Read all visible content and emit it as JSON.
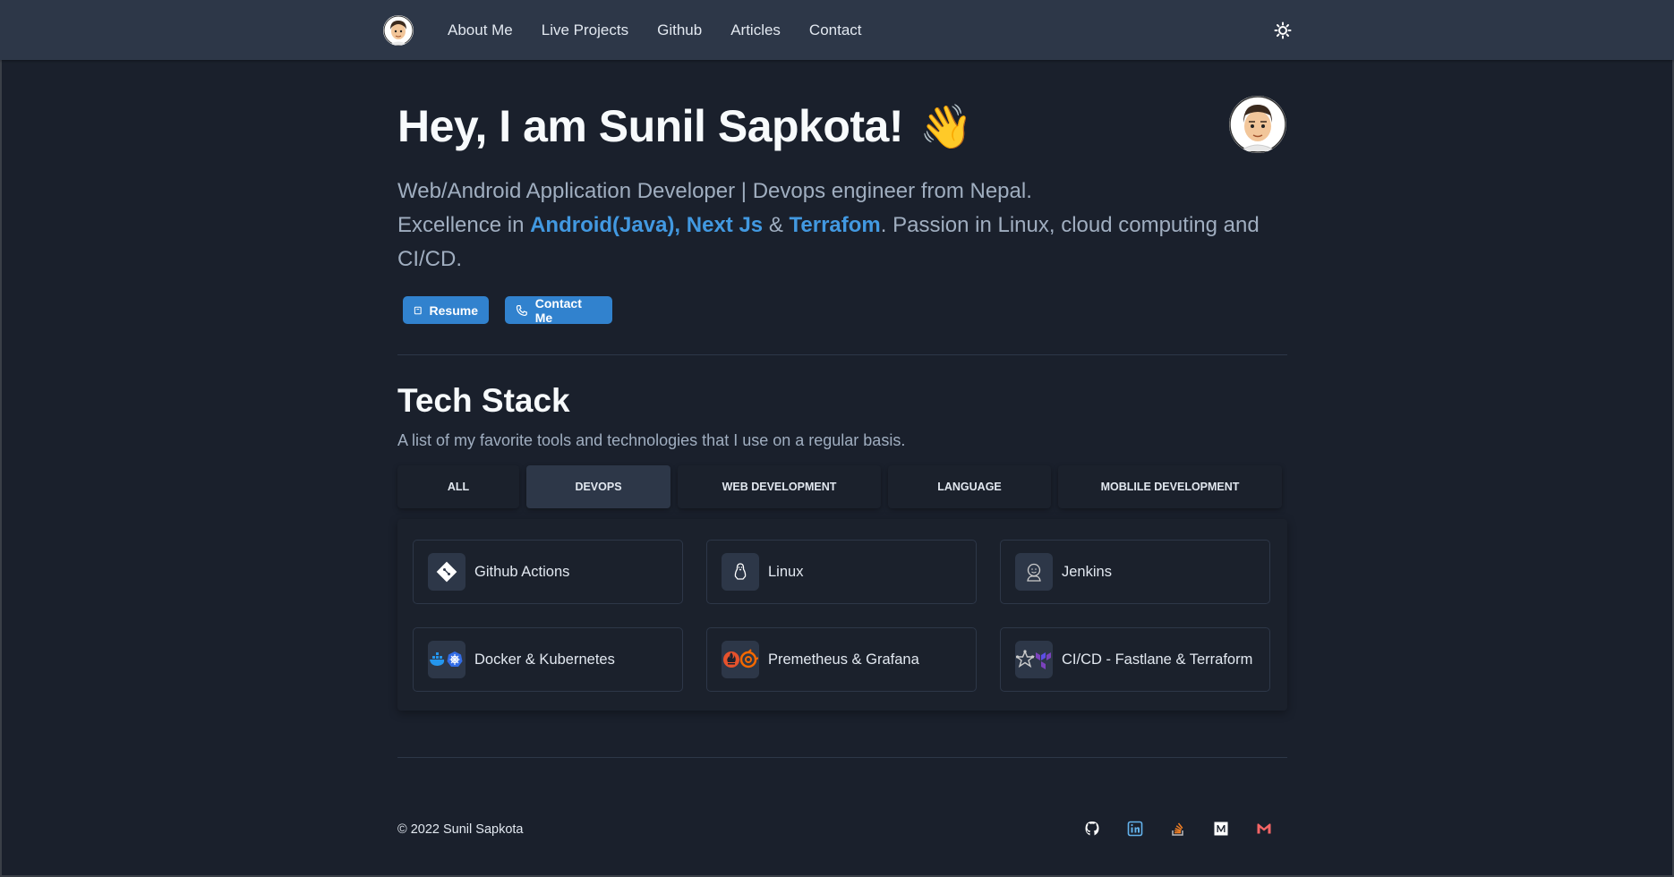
{
  "nav": {
    "links": [
      "About Me",
      "Live Projects",
      "Github",
      "Articles",
      "Contact"
    ]
  },
  "hero": {
    "title": "Hey, I am Sunil Sapkota!",
    "wave": "👋",
    "line1": "Web/Android Application Developer | Devops engineer from Nepal.",
    "line2_prefix": "Excellence in ",
    "highlight1": "Android(Java), Next Js",
    "amp": " & ",
    "highlight2": "Terrafom",
    "line2_suffix": ". Passion in Linux, cloud computing and CI/CD.",
    "resume_label": "Resume",
    "contact_label": "Contact Me"
  },
  "tech": {
    "title": "Tech Stack",
    "description": "A list of my favorite tools and technologies that I use on a regular basis.",
    "tabs": [
      "ALL",
      "DEVOPS",
      "WEB DEVELOPMENT",
      "LANGUAGE",
      "MOBLILE DEVELOPMENT"
    ],
    "active_tab": "DEVOPS",
    "items": [
      {
        "label": "Github Actions",
        "icon": "git-icon"
      },
      {
        "label": "Linux",
        "icon": "linux-icon"
      },
      {
        "label": "Jenkins",
        "icon": "jenkins-icon"
      },
      {
        "label": "Docker & Kubernetes",
        "icon": "docker-kubernetes-icon"
      },
      {
        "label": "Premetheus & Grafana",
        "icon": "prometheus-grafana-icon"
      },
      {
        "label": "CI/CD - Fastlane & Terraform",
        "icon": "fastlane-terraform-icon"
      }
    ]
  },
  "footer": {
    "copyright": "© 2022 Sunil Sapkota",
    "socials": [
      "github-icon",
      "linkedin-icon",
      "stackoverflow-icon",
      "medium-icon",
      "gmail-icon"
    ]
  },
  "colors": {
    "background": "#1a202c",
    "nav": "#2d3748",
    "accent": "#3182ce",
    "highlight": "#4299e1",
    "muted": "#a0aec0"
  }
}
